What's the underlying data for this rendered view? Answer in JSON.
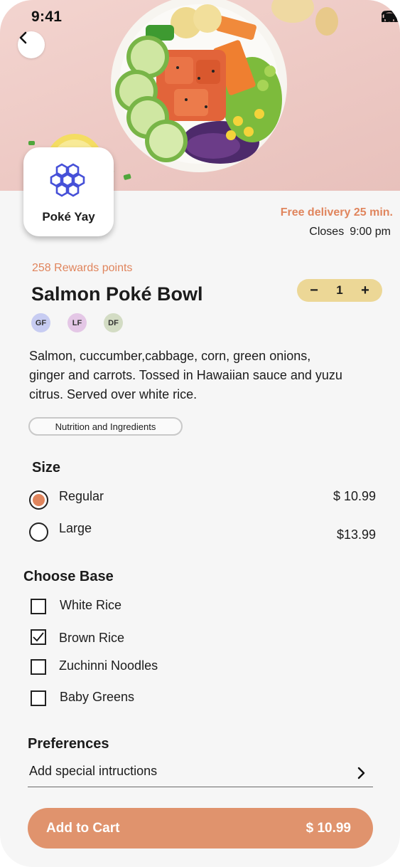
{
  "status_bar": {
    "time": "9:41"
  },
  "restaurant": {
    "name": "Poké Yay",
    "delivery": "Free delivery 25 min.",
    "closes_label": "Closes",
    "closes_time": "9:00 pm"
  },
  "rewards": "258 Rewards points",
  "item": {
    "title": "Salmon Poké Bowl",
    "quantity": "1",
    "dietary_badges": [
      {
        "label": "GF",
        "color": "#c7ccf2"
      },
      {
        "label": "LF",
        "color": "#e4c7e6"
      },
      {
        "label": "DF",
        "color": "#d3dcc4"
      }
    ],
    "description": "Salmon, cuccumber,cabbage, corn, green onions, ginger and carrots. Tossed in Hawaiian sauce and yuzu citrus. Served over white rice.",
    "nutrition_label": "Nutrition and Ingredients"
  },
  "size": {
    "title": "Size",
    "options": [
      {
        "label": "Regular",
        "price": "$ 10.99",
        "selected": true
      },
      {
        "label": "Large",
        "price": "$13.99",
        "selected": false
      }
    ]
  },
  "base": {
    "title": "Choose Base",
    "options": [
      {
        "label": "White Rice",
        "checked": false
      },
      {
        "label": "Brown Rice",
        "checked": true
      },
      {
        "label": "Zuchinni Noodles",
        "checked": false
      },
      {
        "label": "Baby Greens",
        "checked": false
      }
    ]
  },
  "preferences": {
    "title": "Preferences",
    "placeholder": "Add special intructions"
  },
  "cart": {
    "label": "Add to Cart",
    "price": "$ 10.99"
  },
  "colors": {
    "accent": "#e0855d",
    "cart_button": "#e0936d",
    "stepper": "#ecd796",
    "logo_blue": "#4650d8",
    "background": "#f6f6f6"
  }
}
